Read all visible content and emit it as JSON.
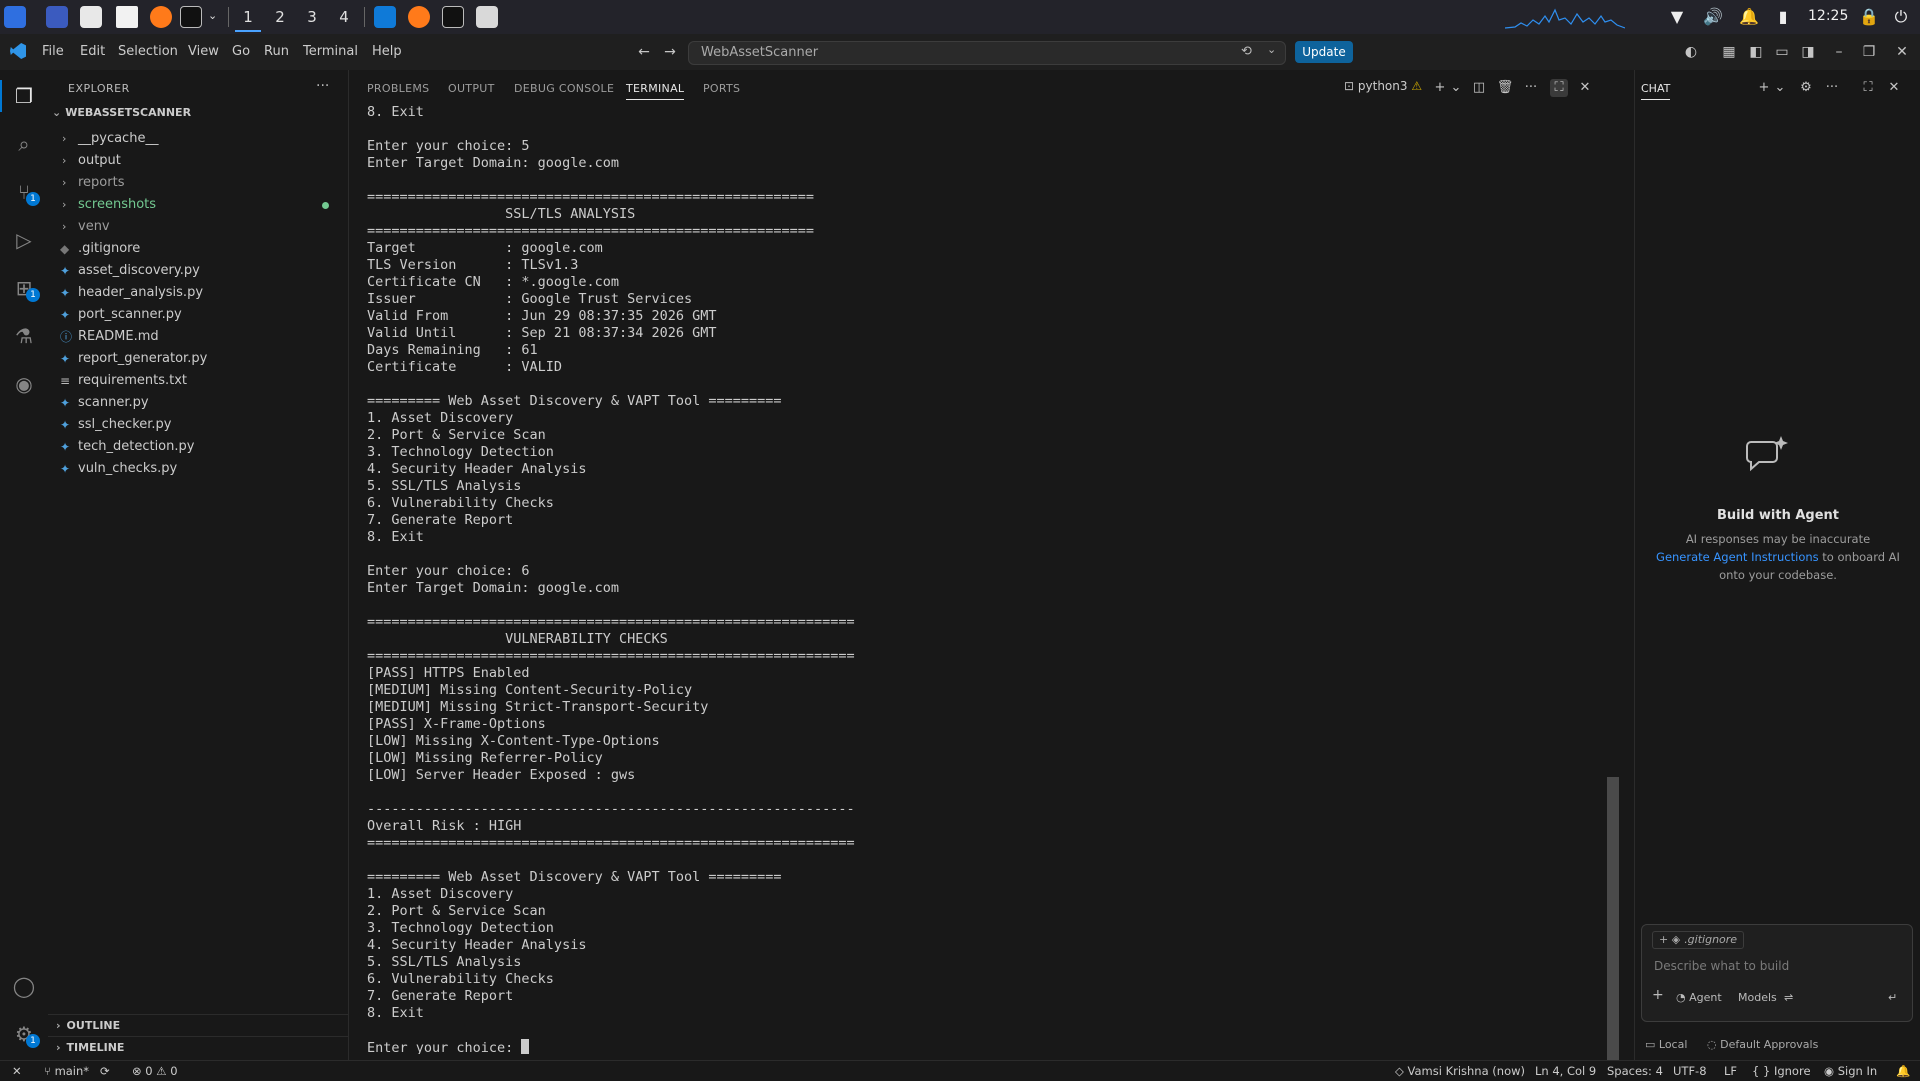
{
  "os": {
    "workspaces": [
      "1",
      "2",
      "3",
      "4"
    ],
    "active_workspace": "1",
    "clock": "12:25"
  },
  "titlebar": {
    "menus": [
      "File",
      "Edit",
      "Selection",
      "View",
      "Go",
      "Run",
      "Terminal",
      "Help"
    ],
    "command_center": "WebAssetScanner",
    "update_label": "Update"
  },
  "activity": {
    "source_control_badge": "1",
    "extensions_badge": "1",
    "settings_badge": "1"
  },
  "explorer": {
    "title": "EXPLORER",
    "folder": "WEBASSETSCANNER",
    "folders": [
      {
        "name": "__pycache__"
      },
      {
        "name": "output"
      },
      {
        "name": "reports"
      },
      {
        "name": "screenshots"
      },
      {
        "name": "venv"
      }
    ],
    "files": [
      {
        "name": ".gitignore"
      },
      {
        "name": "asset_discovery.py"
      },
      {
        "name": "header_analysis.py"
      },
      {
        "name": "port_scanner.py"
      },
      {
        "name": "README.md"
      },
      {
        "name": "report_generator.py"
      },
      {
        "name": "requirements.txt"
      },
      {
        "name": "scanner.py"
      },
      {
        "name": "ssl_checker.py"
      },
      {
        "name": "tech_detection.py"
      },
      {
        "name": "vuln_checks.py"
      }
    ],
    "outline": "OUTLINE",
    "timeline": "TIMELINE"
  },
  "panel": {
    "tabs": [
      "PROBLEMS",
      "OUTPUT",
      "DEBUG CONSOLE",
      "TERMINAL",
      "PORTS"
    ],
    "active_tab": "TERMINAL",
    "terminal_name": "python3",
    "terminal_text": "8. Exit\n\nEnter your choice: 5\nEnter Target Domain: google.com\n\n=======================================================\n                 SSL/TLS ANALYSIS\n=======================================================\nTarget           : google.com\nTLS Version      : TLSv1.3\nCertificate CN   : *.google.com\nIssuer           : Google Trust Services\nValid From       : Jun 29 08:37:35 2026 GMT\nValid Until      : Sep 21 08:37:34 2026 GMT\nDays Remaining   : 61\nCertificate      : VALID\n\n========= Web Asset Discovery & VAPT Tool =========\n1. Asset Discovery\n2. Port & Service Scan\n3. Technology Detection\n4. Security Header Analysis\n5. SSL/TLS Analysis\n6. Vulnerability Checks\n7. Generate Report\n8. Exit\n\nEnter your choice: 6\nEnter Target Domain: google.com\n\n============================================================\n                 VULNERABILITY CHECKS\n============================================================\n[PASS] HTTPS Enabled\n[MEDIUM] Missing Content-Security-Policy\n[MEDIUM] Missing Strict-Transport-Security\n[PASS] X-Frame-Options\n[LOW] Missing X-Content-Type-Options\n[LOW] Missing Referrer-Policy\n[LOW] Server Header Exposed : gws\n\n------------------------------------------------------------\nOverall Risk : HIGH\n============================================================\n\n========= Web Asset Discovery & VAPT Tool =========\n1. Asset Discovery\n2. Port & Service Scan\n3. Technology Detection\n4. Security Header Analysis\n5. SSL/TLS Analysis\n6. Vulnerability Checks\n7. Generate Report\n8. Exit\n\nEnter your choice: "
  },
  "chat": {
    "title": "CHAT",
    "heading": "Build with Agent",
    "note1": "AI responses may be inaccurate",
    "link": "Generate Agent Instructions",
    "note2": " to onboard AI",
    "note3": "onto your codebase.",
    "context_chip": ".gitignore",
    "placeholder": "Describe what to build",
    "agent_label": "Agent",
    "models_label": "Models",
    "local_label": "Local",
    "approvals_label": "Default Approvals"
  },
  "status": {
    "branch": "main*",
    "errors": "0",
    "warnings": "0",
    "author": "Vamsi Krishna (now)",
    "position": "Ln 4, Col 9",
    "spaces": "Spaces: 4",
    "encoding": "UTF-8",
    "eol": "LF",
    "ignore": "Ignore",
    "signin": "Sign In"
  },
  "colors": {
    "accent": "#0078d4",
    "link": "#3794ff",
    "git_untracked": "#73c991"
  }
}
